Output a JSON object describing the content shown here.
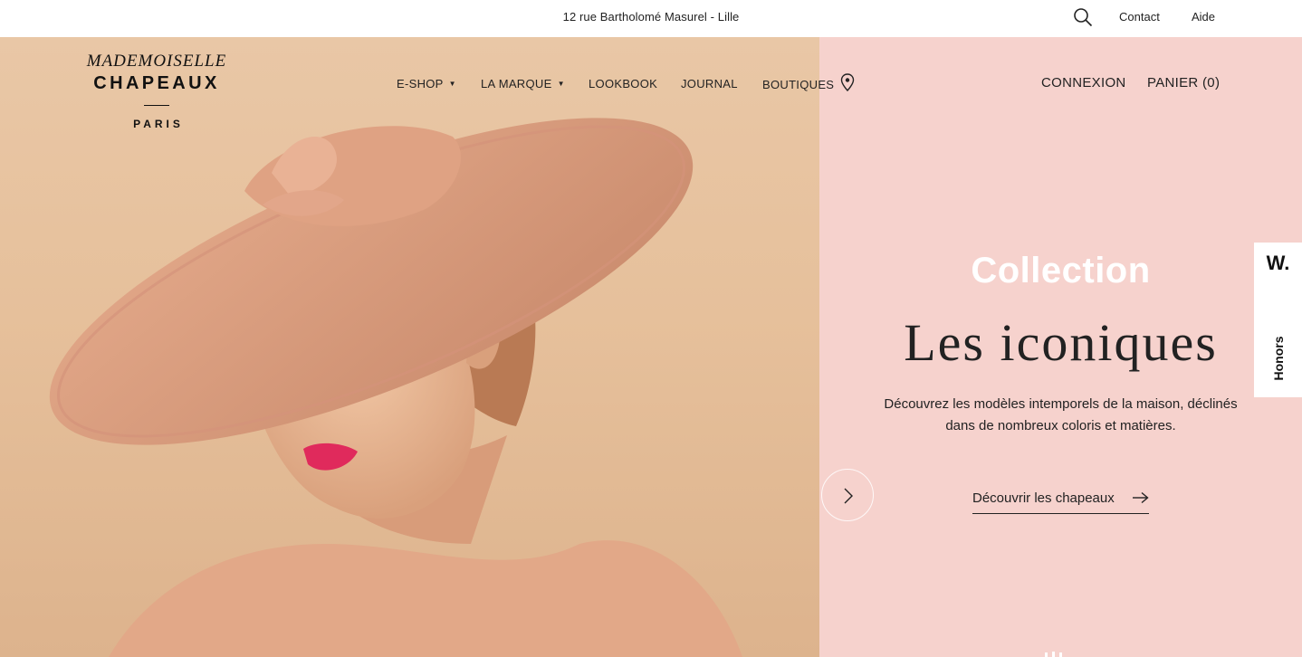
{
  "topbar": {
    "address": "12 rue Bartholomé Masurel - Lille",
    "contact": "Contact",
    "help": "Aide"
  },
  "logo": {
    "line1": "MADEMOISELLE",
    "line2": "CHAPEAUX",
    "line3": "PARIS"
  },
  "nav": {
    "items": [
      {
        "label": "E-SHOP",
        "has_dropdown": true
      },
      {
        "label": "LA MARQUE",
        "has_dropdown": true
      },
      {
        "label": "LOOKBOOK",
        "has_dropdown": false
      },
      {
        "label": "JOURNAL",
        "has_dropdown": false
      },
      {
        "label": "BOUTIQUES",
        "icon": "map-pin-icon"
      }
    ],
    "caret": "▼"
  },
  "account": {
    "login": "CONNEXION",
    "cart": "PANIER (0)"
  },
  "hero": {
    "label": "Collection",
    "title": "Les iconiques",
    "description": "Découvrez les modèles intemporels de la maison, déclinés dans de nombreux coloris et matières.",
    "cta": "Découvrir les chapeaux",
    "panel_color": "#f6d2cd",
    "photo_color": "#e6c09b"
  },
  "badge": {
    "logo": "W.",
    "text": "Honors"
  }
}
